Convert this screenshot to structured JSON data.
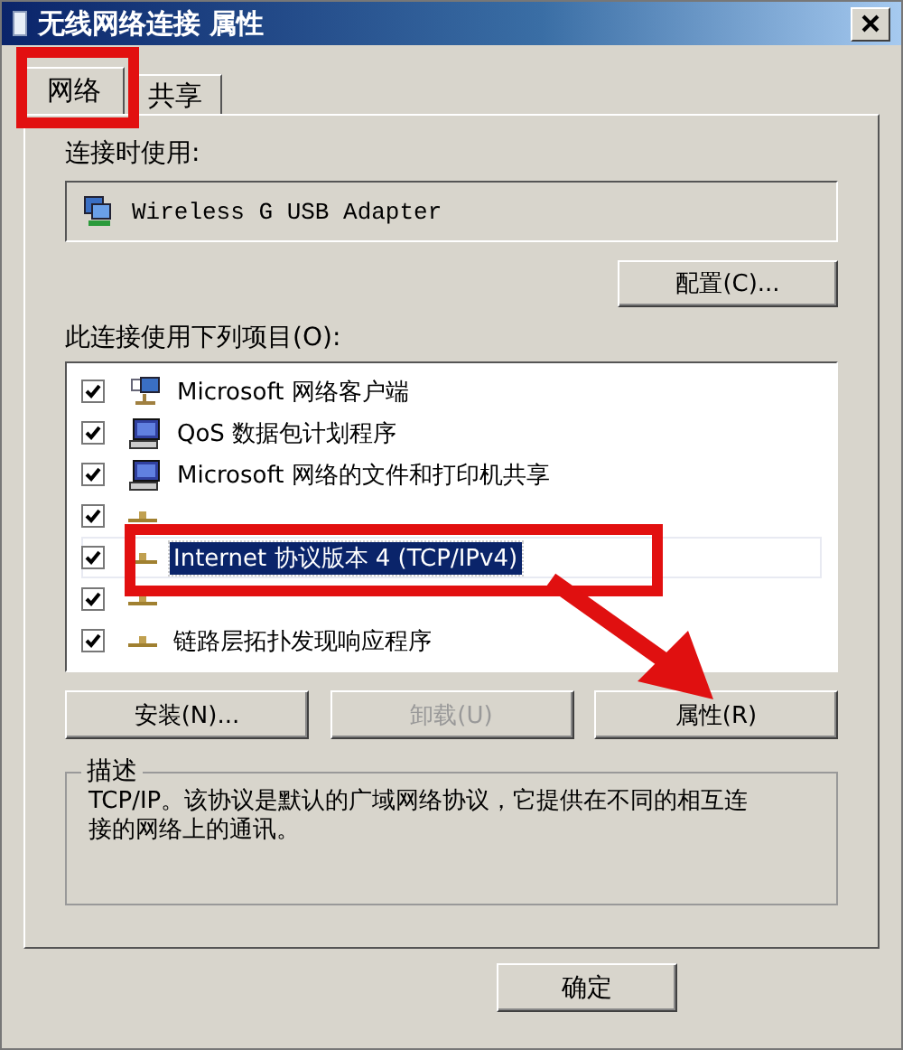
{
  "window": {
    "title": "无线网络连接 属性"
  },
  "tabs": [
    {
      "label": "网络",
      "selected": true
    },
    {
      "label": "共享",
      "selected": false
    }
  ],
  "connect_using": {
    "label": "连接时使用:",
    "adapter": "Wireless G USB Adapter"
  },
  "configure_button": "配置(C)...",
  "components": {
    "label": "此连接使用下列项目(O):",
    "items": [
      {
        "kind": "client",
        "label": "Microsoft 网络客户端",
        "checked": true,
        "selected": false
      },
      {
        "kind": "computer",
        "label": "QoS 数据包计划程序",
        "checked": true,
        "selected": false
      },
      {
        "kind": "computer",
        "label": "Microsoft 网络的文件和打印机共享",
        "checked": true,
        "selected": false
      },
      {
        "kind": "protocol",
        "checked": true,
        "selected": false
      },
      {
        "kind": "protocol",
        "label": "Internet 协议版本 4 (TCP/IPv4)",
        "checked": true,
        "selected": true
      },
      {
        "kind": "protocol",
        "checked": true,
        "selected": false
      },
      {
        "kind": "protocol",
        "label": "链路层拓扑发现响应程序",
        "checked": true,
        "selected": false
      }
    ]
  },
  "buttons": [
    {
      "label": "安装(N)...",
      "disabled": false
    },
    {
      "label": "卸载(U)",
      "disabled": true
    },
    {
      "label": "属性(R)",
      "disabled": false
    }
  ],
  "description": {
    "title": "描述",
    "text": "TCP/IP。该协议是默认的广域网络协议，它提供在不同的相互连接的网络上的通讯。"
  },
  "ok_button": "确定"
}
